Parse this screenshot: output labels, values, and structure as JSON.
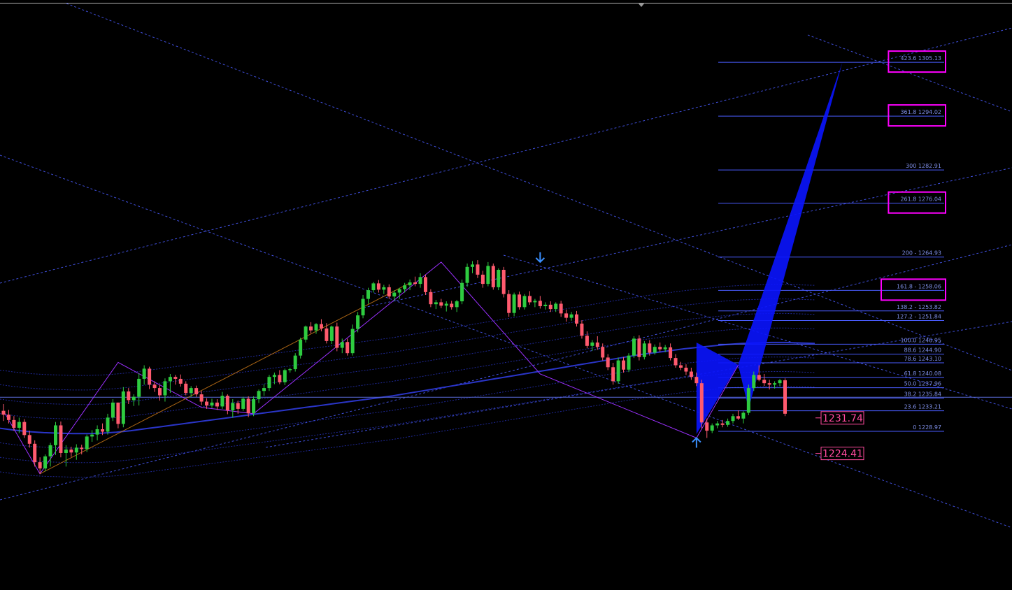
{
  "chart_data": {
    "type": "candlestick",
    "title": "",
    "xlabel": "",
    "ylabel": "",
    "ylim": [
      1212,
      1320
    ],
    "grid": false,
    "colors": {
      "background": "#000000",
      "bull_candle": "#2ecc40",
      "bear_candle": "#ff5a6e",
      "fib_lines": "#4a5cff",
      "fib_text": "#7f8fe8",
      "pattern_fill": "#0a14ff",
      "highlight_box": "#ff00ff",
      "price_tag": "#ff4a9e",
      "channel_lines": "#4a5cff",
      "moving_average": "#2a35c8",
      "zigzag": "#9b30ff",
      "arrow": "#3a8fff"
    },
    "fibonacci_levels": [
      {
        "ratio": "423.6",
        "price": "1305.13",
        "label": "423.6 1305.13",
        "highlighted": true
      },
      {
        "ratio": "361.8",
        "price": "1294.02",
        "label": "361.8 1294.02",
        "highlighted": true
      },
      {
        "ratio": "300",
        "price": "1282.91",
        "label": "300 1282.91",
        "highlighted": false
      },
      {
        "ratio": "261.8",
        "price": "1276.04",
        "label": "261.8 1276.04",
        "highlighted": true
      },
      {
        "ratio": "200",
        "price": "1264.93",
        "label": "200 - 1264.93",
        "highlighted": false
      },
      {
        "ratio": "161.8",
        "price": "1258.06",
        "label": "161.8 - 1258.06",
        "highlighted": true
      },
      {
        "ratio": "138.2",
        "price": "1253.82",
        "label": "138.2 - 1253.82",
        "highlighted": false
      },
      {
        "ratio": "127.2",
        "price": "1251.84",
        "label": "127.2 - 1251.84",
        "highlighted": false
      },
      {
        "ratio": "100.0",
        "price": "1246.95",
        "label": "100.0 1246.95",
        "highlighted": false
      },
      {
        "ratio": "88.6",
        "price": "1244.90",
        "label": "88.6 1244.90",
        "highlighted": false
      },
      {
        "ratio": "78.6",
        "price": "1243.10",
        "label": "78.6 1243.10",
        "highlighted": false
      },
      {
        "ratio": "61.8",
        "price": "1240.08",
        "label": "61.8 1240.08",
        "highlighted": false
      },
      {
        "ratio": "50.0",
        "price": "1237.96",
        "label": "50.0 1237.96",
        "highlighted": false
      },
      {
        "ratio": "38.2",
        "price": "1235.84",
        "label": "38.2 1235.84",
        "highlighted": false
      },
      {
        "ratio": "23.6",
        "price": "1233.21",
        "label": "23.6 1233.21",
        "highlighted": false
      },
      {
        "ratio": "0",
        "price": "1228.97",
        "label": "0 1228.97",
        "highlighted": false
      }
    ],
    "price_markers": [
      {
        "label": "1231.74",
        "value": 1231.74
      },
      {
        "label": "1224.41",
        "value": 1224.41
      }
    ],
    "current_price_line": 1236.0,
    "candles": [
      [
        1233.2,
        1234.6,
        1231.1,
        1232.4
      ],
      [
        1232.4,
        1233.4,
        1230.6,
        1231.3
      ],
      [
        1231.3,
        1232.1,
        1229.1,
        1229.7
      ],
      [
        1229.7,
        1231.8,
        1228.6,
        1230.9
      ],
      [
        1230.9,
        1231.5,
        1227.6,
        1228.2
      ],
      [
        1228.2,
        1229.1,
        1225.6,
        1226.4
      ],
      [
        1226.4,
        1227.1,
        1221.7,
        1222.6
      ],
      [
        1222.6,
        1223.6,
        1220.2,
        1221.3
      ],
      [
        1221.3,
        1224.2,
        1220.7,
        1223.8
      ],
      [
        1223.8,
        1226.6,
        1221.7,
        1226.1
      ],
      [
        1226.1,
        1230.9,
        1224.1,
        1230.2
      ],
      [
        1230.2,
        1231.0,
        1223.6,
        1224.5
      ],
      [
        1224.5,
        1226.1,
        1221.7,
        1225.2
      ],
      [
        1225.2,
        1225.8,
        1223.7,
        1224.6
      ],
      [
        1224.6,
        1226.3,
        1223.1,
        1225.6
      ],
      [
        1225.6,
        1226.2,
        1224.2,
        1225.3
      ],
      [
        1225.3,
        1228.3,
        1224.7,
        1227.9
      ],
      [
        1227.9,
        1229.2,
        1226.8,
        1228.3
      ],
      [
        1228.3,
        1230.2,
        1227.1,
        1229.4
      ],
      [
        1229.4,
        1230.6,
        1228.2,
        1228.9
      ],
      [
        1228.9,
        1232.6,
        1228.3,
        1231.8
      ],
      [
        1231.8,
        1235.6,
        1231.1,
        1234.9
      ],
      [
        1234.9,
        1234.9,
        1229.6,
        1230.5
      ],
      [
        1230.5,
        1238.1,
        1229.8,
        1237.2
      ],
      [
        1237.2,
        1237.9,
        1234.6,
        1235.4
      ],
      [
        1235.4,
        1236.6,
        1234.2,
        1236.1
      ],
      [
        1236.1,
        1240.9,
        1234.3,
        1239.8
      ],
      [
        1239.8,
        1242.6,
        1238.6,
        1241.9
      ],
      [
        1241.9,
        1242.3,
        1237.7,
        1238.6
      ],
      [
        1238.6,
        1239.3,
        1237.1,
        1237.9
      ],
      [
        1237.9,
        1238.6,
        1235.3,
        1236.4
      ],
      [
        1236.4,
        1239.9,
        1235.1,
        1239.3
      ],
      [
        1239.3,
        1240.8,
        1236.9,
        1240.2
      ],
      [
        1240.2,
        1240.6,
        1238.6,
        1239.8
      ],
      [
        1239.8,
        1240.7,
        1238.2,
        1238.8
      ],
      [
        1238.8,
        1239.3,
        1236.4,
        1236.9
      ],
      [
        1236.9,
        1238.3,
        1236.1,
        1237.9
      ],
      [
        1237.9,
        1238.4,
        1236.1,
        1236.6
      ],
      [
        1236.6,
        1237.3,
        1234.4,
        1235.1
      ],
      [
        1235.1,
        1235.8,
        1233.6,
        1234.3
      ],
      [
        1234.3,
        1235.7,
        1233.8,
        1234.9
      ],
      [
        1234.9,
        1235.6,
        1233.4,
        1234.1
      ],
      [
        1234.1,
        1237.1,
        1233.6,
        1236.3
      ],
      [
        1236.3,
        1236.6,
        1232.5,
        1233.3
      ],
      [
        1233.3,
        1235.6,
        1231.8,
        1234.8
      ],
      [
        1234.8,
        1235.3,
        1232.6,
        1233.6
      ],
      [
        1233.6,
        1236.1,
        1233.2,
        1235.7
      ],
      [
        1235.7,
        1236.2,
        1231.9,
        1232.7
      ],
      [
        1232.7,
        1236.2,
        1232.1,
        1235.6
      ],
      [
        1235.6,
        1237.6,
        1234.8,
        1237.3
      ],
      [
        1237.3,
        1238.7,
        1236.3,
        1237.9
      ],
      [
        1237.9,
        1240.6,
        1237.3,
        1240.2
      ],
      [
        1240.2,
        1241.1,
        1238.7,
        1240.6
      ],
      [
        1240.6,
        1241.6,
        1238.7,
        1239.1
      ],
      [
        1239.1,
        1241.9,
        1238.5,
        1241.6
      ],
      [
        1241.6,
        1242.1,
        1241.1,
        1241.8
      ],
      [
        1241.8,
        1245.1,
        1241.3,
        1244.6
      ],
      [
        1244.6,
        1248.3,
        1244.0,
        1247.9
      ],
      [
        1247.9,
        1250.8,
        1247.3,
        1250.6
      ],
      [
        1250.6,
        1251.5,
        1249.2,
        1249.8
      ],
      [
        1249.8,
        1251.3,
        1249.1,
        1251.1
      ],
      [
        1251.1,
        1252.1,
        1249.6,
        1250.2
      ],
      [
        1250.2,
        1251.3,
        1247.1,
        1247.6
      ],
      [
        1247.6,
        1250.8,
        1247.0,
        1250.6
      ],
      [
        1250.6,
        1251.4,
        1245.5,
        1246.2
      ],
      [
        1246.2,
        1248.1,
        1245.1,
        1247.4
      ],
      [
        1247.4,
        1248.1,
        1244.6,
        1245.1
      ],
      [
        1245.1,
        1251.0,
        1244.6,
        1250.1
      ],
      [
        1250.1,
        1253.6,
        1249.4,
        1252.9
      ],
      [
        1252.9,
        1257.1,
        1252.3,
        1256.3
      ],
      [
        1256.3,
        1258.6,
        1255.3,
        1258.1
      ],
      [
        1258.1,
        1259.8,
        1257.6,
        1259.5
      ],
      [
        1259.5,
        1260.2,
        1257.6,
        1258.2
      ],
      [
        1258.2,
        1259.2,
        1257.3,
        1258.7
      ],
      [
        1258.7,
        1259.3,
        1256.3,
        1256.8
      ],
      [
        1256.8,
        1258.1,
        1255.9,
        1257.6
      ],
      [
        1257.6,
        1258.6,
        1256.3,
        1258.3
      ],
      [
        1258.3,
        1259.6,
        1257.6,
        1259.1
      ],
      [
        1259.1,
        1260.3,
        1258.1,
        1259.7
      ],
      [
        1259.7,
        1260.9,
        1258.9,
        1259.4
      ],
      [
        1259.4,
        1261.6,
        1258.6,
        1260.8
      ],
      [
        1260.8,
        1261.3,
        1257.1,
        1257.7
      ],
      [
        1257.7,
        1258.3,
        1254.6,
        1255.2
      ],
      [
        1255.2,
        1256.1,
        1254.2,
        1255.6
      ],
      [
        1255.6,
        1256.3,
        1254.4,
        1254.9
      ],
      [
        1254.9,
        1255.8,
        1253.7,
        1255.3
      ],
      [
        1255.3,
        1255.9,
        1254.1,
        1254.6
      ],
      [
        1254.6,
        1256.1,
        1253.6,
        1255.8
      ],
      [
        1255.8,
        1260.3,
        1255.2,
        1259.6
      ],
      [
        1259.6,
        1263.6,
        1258.8,
        1262.9
      ],
      [
        1262.9,
        1264.1,
        1261.6,
        1263.4
      ],
      [
        1263.4,
        1264.3,
        1260.6,
        1261.3
      ],
      [
        1261.3,
        1262.1,
        1258.6,
        1259.4
      ],
      [
        1259.4,
        1263.9,
        1258.9,
        1263.1
      ],
      [
        1263.1,
        1263.6,
        1258.2,
        1258.7
      ],
      [
        1258.7,
        1262.6,
        1258.1,
        1262.3
      ],
      [
        1262.3,
        1262.9,
        1256.6,
        1257.3
      ],
      [
        1257.3,
        1258.1,
        1252.6,
        1253.4
      ],
      [
        1253.4,
        1257.6,
        1252.7,
        1257.2
      ],
      [
        1257.2,
        1257.8,
        1254.1,
        1254.6
      ],
      [
        1254.6,
        1257.3,
        1254.1,
        1256.9
      ],
      [
        1256.9,
        1257.9,
        1255.1,
        1255.6
      ],
      [
        1255.6,
        1256.3,
        1254.6,
        1255.9
      ],
      [
        1255.9,
        1256.9,
        1254.3,
        1254.8
      ],
      [
        1254.8,
        1255.6,
        1254.1,
        1255.1
      ],
      [
        1255.1,
        1255.8,
        1253.6,
        1254.2
      ],
      [
        1254.2,
        1255.6,
        1253.6,
        1255.3
      ],
      [
        1255.3,
        1255.9,
        1252.6,
        1253.3
      ],
      [
        1253.3,
        1254.1,
        1251.6,
        1252.4
      ],
      [
        1252.4,
        1253.6,
        1251.8,
        1253.1
      ],
      [
        1253.1,
        1253.8,
        1250.6,
        1251.2
      ],
      [
        1251.2,
        1251.9,
        1248.1,
        1248.7
      ],
      [
        1248.7,
        1249.6,
        1246.1,
        1246.6
      ],
      [
        1246.6,
        1247.8,
        1245.6,
        1247.3
      ],
      [
        1247.3,
        1248.6,
        1245.8,
        1246.4
      ],
      [
        1246.4,
        1247.1,
        1243.6,
        1244.2
      ],
      [
        1244.2,
        1244.9,
        1241.6,
        1242.2
      ],
      [
        1242.2,
        1243.1,
        1238.6,
        1239.3
      ],
      [
        1239.3,
        1244.2,
        1238.8,
        1243.6
      ],
      [
        1243.6,
        1244.3,
        1241.1,
        1241.7
      ],
      [
        1241.7,
        1245.1,
        1241.2,
        1244.6
      ],
      [
        1244.6,
        1248.6,
        1244.1,
        1248.1
      ],
      [
        1248.1,
        1248.8,
        1243.6,
        1244.3
      ],
      [
        1244.3,
        1247.6,
        1243.8,
        1247.1
      ],
      [
        1247.1,
        1247.8,
        1244.6,
        1245.2
      ],
      [
        1245.2,
        1246.9,
        1244.8,
        1246.4
      ],
      [
        1246.4,
        1247.3,
        1245.4,
        1245.9
      ],
      [
        1245.9,
        1246.8,
        1245.3,
        1246.3
      ],
      [
        1246.3,
        1247.1,
        1243.6,
        1244.1
      ],
      [
        1244.1,
        1244.9,
        1242.1,
        1242.6
      ],
      [
        1242.6,
        1243.3,
        1241.6,
        1242.1
      ],
      [
        1242.1,
        1242.8,
        1240.6,
        1241.3
      ],
      [
        1241.3,
        1242.1,
        1239.6,
        1240.2
      ],
      [
        1240.2,
        1241.1,
        1238.3,
        1238.9
      ],
      [
        1238.9,
        1239.6,
        1229.6,
        1230.8
      ],
      [
        1230.8,
        1231.6,
        1227.6,
        1229.1
      ],
      [
        1229.1,
        1230.6,
        1228.6,
        1230.2
      ],
      [
        1230.2,
        1231.1,
        1229.6,
        1230.6
      ],
      [
        1230.6,
        1231.3,
        1229.8,
        1230.3
      ],
      [
        1230.3,
        1231.6,
        1229.9,
        1231.1
      ],
      [
        1231.1,
        1232.6,
        1230.6,
        1232.1
      ],
      [
        1232.1,
        1233.3,
        1231.3,
        1231.6
      ],
      [
        1231.6,
        1233.1,
        1230.6,
        1232.8
      ],
      [
        1232.8,
        1238.6,
        1232.3,
        1237.9
      ],
      [
        1237.9,
        1241.3,
        1237.3,
        1240.6
      ],
      [
        1240.6,
        1242.6,
        1239.3,
        1239.6
      ],
      [
        1239.6,
        1240.8,
        1238.3,
        1238.9
      ],
      [
        1238.9,
        1239.6,
        1237.6,
        1238.6
      ],
      [
        1238.6,
        1239.3,
        1237.8,
        1238.9
      ],
      [
        1238.9,
        1239.8,
        1238.3,
        1239.5
      ],
      [
        1239.5,
        1239.9,
        1232.1,
        1232.6
      ]
    ],
    "series": [
      {
        "values": [
          1229.6,
          1229.2,
          1228.9,
          1228.7,
          1228.6,
          1228.5,
          1228.5,
          1228.6,
          1228.8,
          1229.1,
          1229.5,
          1229.9,
          1230.3,
          1230.7,
          1231.1,
          1231.5,
          1231.9,
          1232.3,
          1232.7,
          1233.1,
          1233.5,
          1233.9,
          1234.3,
          1234.7,
          1235.1,
          1235.5,
          1235.9,
          1236.3,
          1236.8,
          1237.3,
          1237.8,
          1238.3,
          1238.8,
          1239.3,
          1239.8,
          1240.3,
          1240.8,
          1241.3,
          1241.8,
          1242.3,
          1242.8,
          1243.3,
          1243.8,
          1244.3,
          1244.8,
          1245.2,
          1245.6,
          1246.0,
          1246.3,
          1246.6,
          1246.9,
          1247.1,
          1247.2,
          1247.3,
          1247.3,
          1247.2,
          1247.1
        ]
      },
      {
        "values": [
          1234.2,
          1233.8,
          1233.5,
          1233.3,
          1233.2,
          1233.1,
          1233.1,
          1233.2,
          1233.4,
          1233.7,
          1234.1,
          1234.5,
          1234.9,
          1235.3,
          1235.7,
          1236.1,
          1236.5,
          1236.9,
          1237.3,
          1237.7,
          1238.1,
          1238.5,
          1238.9,
          1239.3,
          1239.7,
          1240.1,
          1240.5,
          1240.9,
          1241.4,
          1241.9,
          1242.4,
          1242.9,
          1243.4,
          1243.9,
          1244.4,
          1244.9,
          1245.4,
          1245.9,
          1246.4,
          1246.9,
          1247.4,
          1247.9,
          1248.4,
          1248.9,
          1249.4,
          1249.8,
          1250.2,
          1250.6,
          1250.9,
          1251.2,
          1251.5,
          1251.7,
          1251.8,
          1251.9,
          1251.9,
          1251.8,
          1251.7
        ]
      },
      {
        "values": [
          1224.2,
          1223.8,
          1223.5,
          1223.3,
          1223.2,
          1223.1,
          1223.1,
          1223.2,
          1223.4,
          1223.7,
          1224.1,
          1224.5,
          1224.9,
          1225.3,
          1225.7,
          1226.1,
          1226.5,
          1226.9,
          1227.3,
          1227.7,
          1228.1,
          1228.5,
          1228.9,
          1229.3,
          1229.7,
          1230.1,
          1230.5,
          1230.9,
          1231.4,
          1231.9,
          1232.4,
          1232.9,
          1233.4,
          1233.9,
          1234.4,
          1234.9,
          1235.4,
          1235.9,
          1236.4,
          1236.9,
          1237.4,
          1237.9,
          1238.4,
          1238.9,
          1239.4,
          1239.8,
          1240.2,
          1240.6,
          1240.9,
          1241.2,
          1241.5,
          1241.7,
          1241.8,
          1241.9,
          1241.9,
          1241.8,
          1241.7
        ]
      }
    ],
    "zigzag_pivots": [
      [
        0,
        1233.2
      ],
      [
        7,
        1220.2
      ],
      [
        22,
        1243.2
      ],
      [
        38,
        1233.9
      ],
      [
        48,
        1232.6
      ],
      [
        84,
        1263.9
      ],
      [
        103,
        1240.8
      ],
      [
        133,
        1227.6
      ],
      [
        141,
        1242.6
      ]
    ],
    "harmonic_pattern": [
      [
        133,
        1247.3
      ],
      [
        133,
        1228.4
      ],
      [
        141,
        1242.7
      ],
      [
        143,
        1233.6
      ],
      [
        161,
        1305.13
      ]
    ]
  }
}
